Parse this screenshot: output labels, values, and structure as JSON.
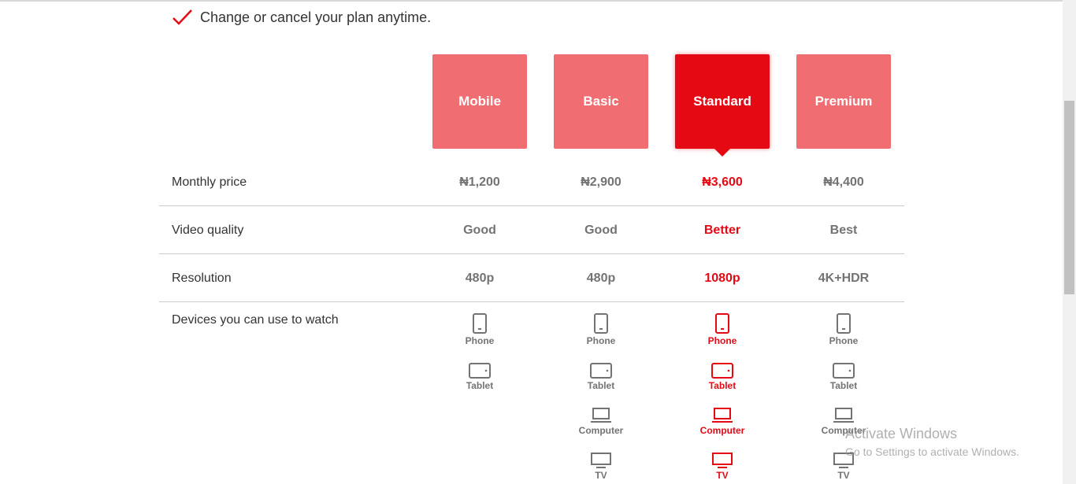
{
  "perk": {
    "text": "Change or cancel your plan anytime."
  },
  "plans": [
    {
      "name": "Mobile",
      "selected": false
    },
    {
      "name": "Basic",
      "selected": false
    },
    {
      "name": "Standard",
      "selected": true
    },
    {
      "name": "Premium",
      "selected": false
    }
  ],
  "rows": {
    "price": {
      "label": "Monthly price",
      "values": [
        "₦1,200",
        "₦2,900",
        "₦3,600",
        "₦4,400"
      ]
    },
    "quality": {
      "label": "Video quality",
      "values": [
        "Good",
        "Good",
        "Better",
        "Best"
      ]
    },
    "resolution": {
      "label": "Resolution",
      "values": [
        "480p",
        "480p",
        "1080p",
        "4K+HDR"
      ]
    },
    "devices": {
      "label": "Devices you can use to watch",
      "names": {
        "phone": "Phone",
        "tablet": "Tablet",
        "computer": "Computer",
        "tv": "TV"
      }
    }
  },
  "colors": {
    "brand_red": "#e50914",
    "card_pink": "#f06d72",
    "muted_text": "#737373"
  },
  "watermark": {
    "title": "Activate Windows",
    "subtitle": "Go to Settings to activate Windows."
  }
}
